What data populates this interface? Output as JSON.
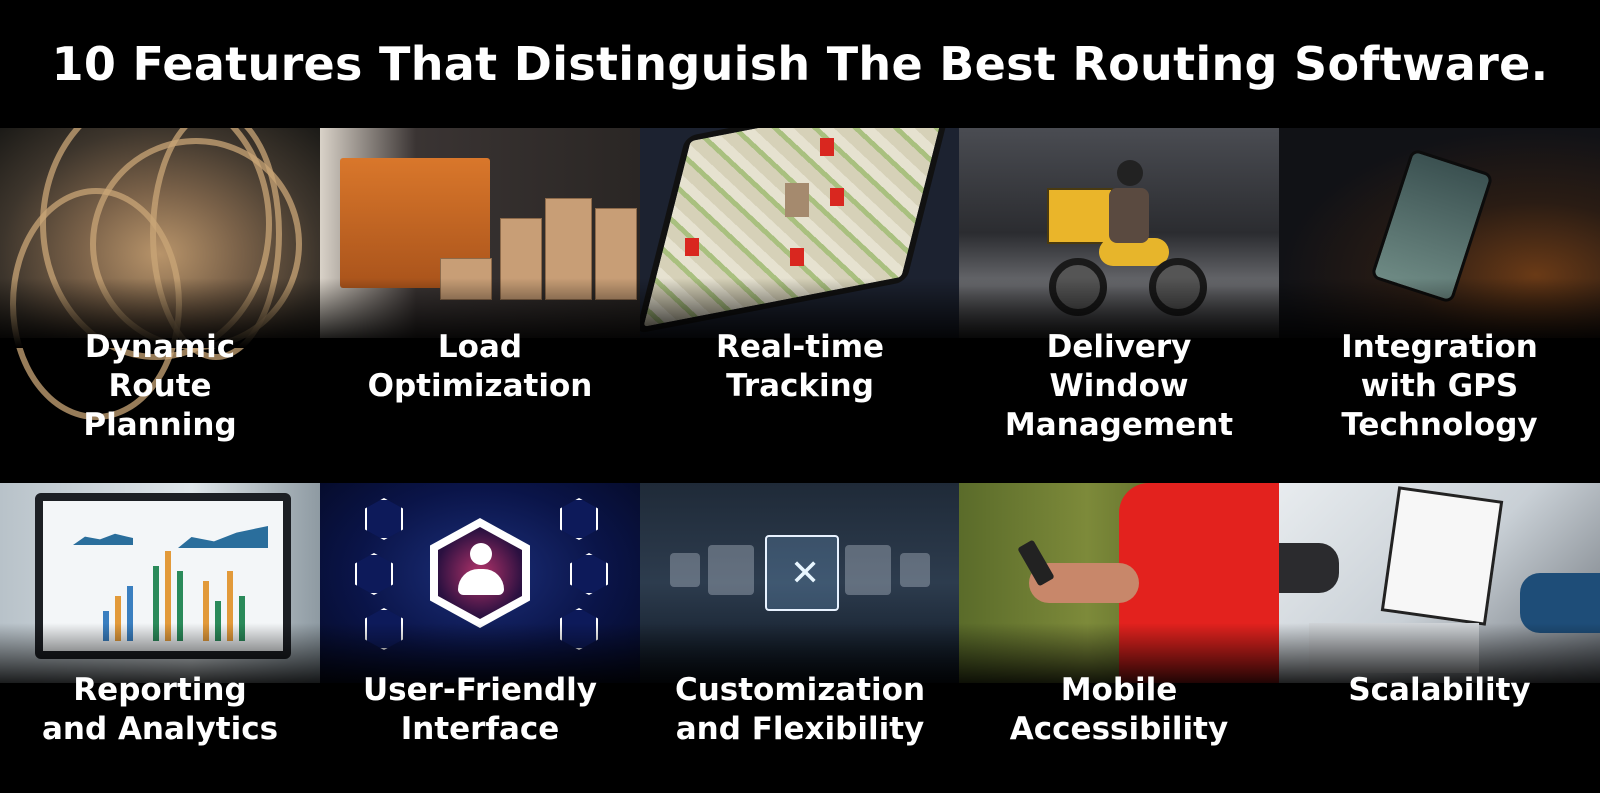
{
  "title": "10 Features That Distinguish The Best Routing Software.",
  "features": [
    {
      "lines": [
        "Dynamic",
        "Route",
        "Planning"
      ],
      "image": "aerial-highway-interchange"
    },
    {
      "lines": [
        "Load",
        "Optimization"
      ],
      "image": "orange-truck-warehouse"
    },
    {
      "lines": [
        "Real-time",
        "Tracking"
      ],
      "image": "smartphone-map-with-pins"
    },
    {
      "lines": [
        "Delivery",
        "Window",
        "Management"
      ],
      "image": "delivery-motorcycle"
    },
    {
      "lines": [
        "Integration",
        "with GPS",
        "Technology"
      ],
      "image": "phone-car-mount"
    },
    {
      "lines": [
        "Reporting",
        "and Analytics"
      ],
      "image": "laptop-dashboard-charts"
    },
    {
      "lines": [
        "User-Friendly",
        "Interface"
      ],
      "image": "hexagon-users-icon-touch"
    },
    {
      "lines": [
        "Customization",
        "and Flexibility"
      ],
      "image": "tools-icons-tablet"
    },
    {
      "lines": [
        "Mobile",
        "Accessibility"
      ],
      "image": "person-holding-phone"
    },
    {
      "lines": [
        "Scalability"
      ],
      "image": "business-chart-clipboard"
    }
  ]
}
